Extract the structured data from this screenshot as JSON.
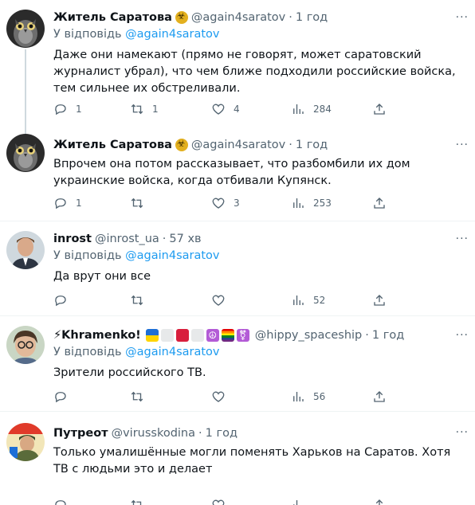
{
  "tweets": [
    {
      "name": "Житель Саратова",
      "handle": "@again4saratov",
      "time": "1 год",
      "reply_prefix": "У відповідь",
      "reply_to": "@again4saratov",
      "text": "Даже они намекают (прямо не говорят, может саратовский журналист убрал), что чем ближе подходили российские войска, тем сильнее их обстреливали.",
      "replies": "1",
      "retweets": "1",
      "likes": "4",
      "views": "284"
    },
    {
      "name": "Житель Саратова",
      "handle": "@again4saratov",
      "time": "1 год",
      "text": "Впрочем она потом рассказывает, что разбомбили их дом украинские войска, когда отбивали Купянск.",
      "replies": "1",
      "retweets": "",
      "likes": "3",
      "views": "253"
    },
    {
      "name": "inrost",
      "handle": "@inrost_ua",
      "time": "57 хв",
      "reply_prefix": "У відповідь",
      "reply_to": "@again4saratov",
      "text": "Да врут они все",
      "replies": "",
      "retweets": "",
      "likes": "",
      "views": "52"
    },
    {
      "name": "⚡Khramenko!",
      "handle": "@hippy_spaceship",
      "time": "1 год",
      "reply_prefix": "У відповідь",
      "reply_to": "@again4saratov",
      "text": "Зрители российского ТВ.",
      "replies": "",
      "retweets": "",
      "likes": "",
      "views": "56"
    },
    {
      "name": "Путреот",
      "handle": "@virusskodina",
      "time": "1 год",
      "text": "Только умалишённые могли поменять Харьков на Саратов. Хотя ТВ с людьми это и делает"
    }
  ],
  "dot": "·",
  "more": "···",
  "colors": {
    "link": "#1d9bf0",
    "muted": "#536471",
    "divider": "#eff3f4"
  }
}
